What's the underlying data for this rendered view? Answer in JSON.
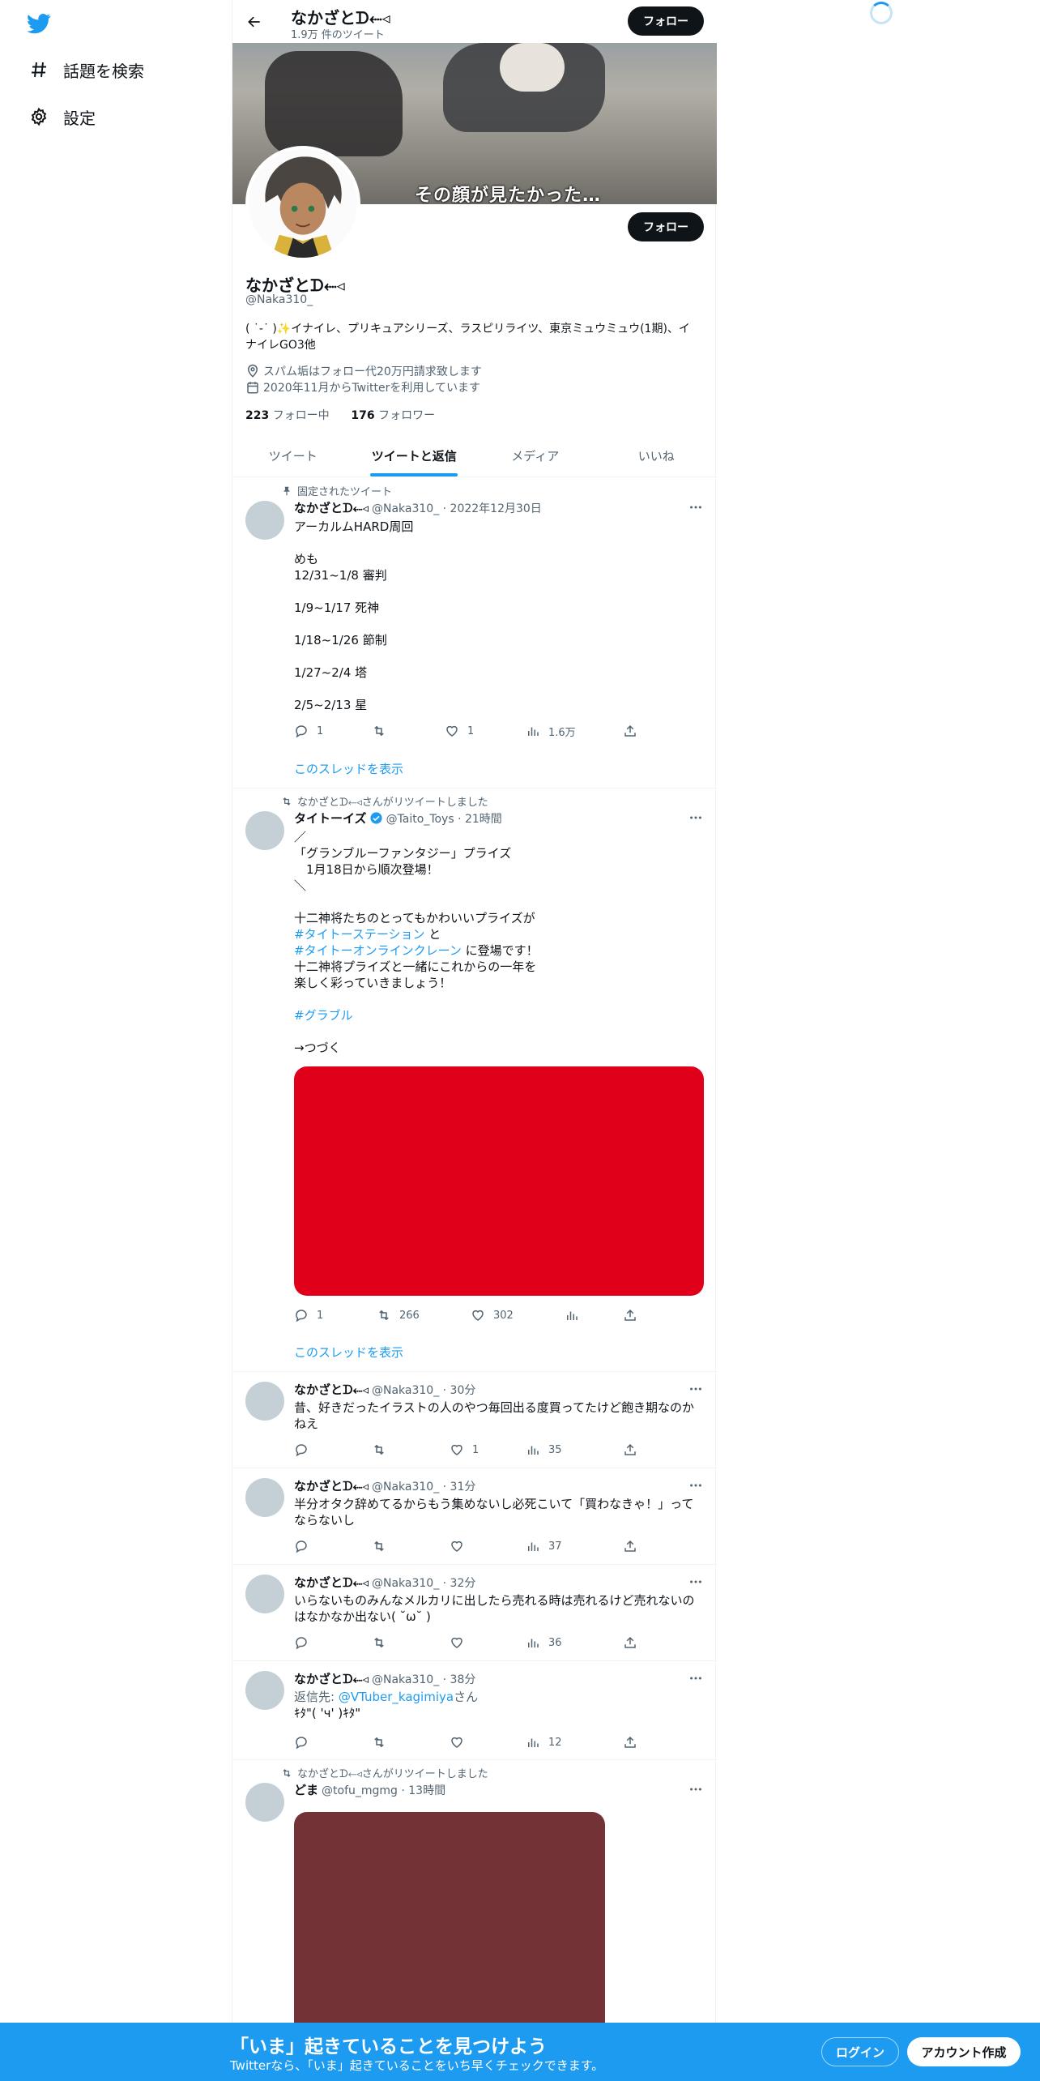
{
  "nav": {
    "explore_label": "話題を検索",
    "settings_label": "設定"
  },
  "topbar": {
    "name": "なかざとᗪ⬸◃",
    "tweet_count": "1.9万 件のツイート",
    "follow_label": "フォロー"
  },
  "banner": {
    "caption": "その顔が見たかった…"
  },
  "profile": {
    "follow_label": "フォロー",
    "name": "なかざとᗪ⬸◃",
    "handle": "@Naka310_",
    "bio": "( ˙-˙ )✨イナイレ、プリキュアシリーズ、ラスピリライツ、東京ミュウミュウ(1期)、イナイレGO3他",
    "location": "スパム垢はフォロー代20万円請求致します",
    "joined": "2020年11月からTwitterを利用しています",
    "following_count": "223",
    "following_label": "フォロー中",
    "followers_count": "176",
    "followers_label": "フォロワー"
  },
  "tabs": [
    "ツイート",
    "ツイートと返信",
    "メディア",
    "いいね"
  ],
  "active_tab": "ツイートと返信",
  "tweets": [
    {
      "context": "固定されたツイート",
      "name": "なかざとᗪ⬸◃",
      "handle_time": "@Naka310_ · 2022年12月30日",
      "body": "アーカルムHARD周回\n\nめも\n12/31~1/8 審判\n\n1/9~1/17 死神\n\n1/18~1/26 節制\n\n1/27~2/4 塔\n\n2/5~2/13 星",
      "replies": "1",
      "retweets": "",
      "likes": "1",
      "views": "1.6万",
      "thread_label": "このスレッドを表示"
    },
    {
      "context": "なかざとᗪ⬸◃さんがリツイートしました",
      "name": "タイトーイズ",
      "handle_time": "@Taito_Toys · 21時間",
      "body_1": "／\n「グランブルーファンタジー」プライズ\n　1月18日から順次登場！\n＼\n\n十二神将たちのとってもかわいいプライズが",
      "hashtag_1": "#タイトーステーション",
      "body_2": " と",
      "hashtag_2": "#タイトーオンラインクレーン",
      "body_3": " に登場です！\n十二神将プライズと一緒にこれからの一年を\n楽しく彩っていきましょう！",
      "hashtag_3": "#グラブル",
      "body_4": "→つづく",
      "replies": "1",
      "retweets": "266",
      "likes": "302",
      "views": "",
      "thread_label": "このスレッドを表示",
      "media_color": "#e00019"
    },
    {
      "name": "なかざとᗪ⬸◃",
      "handle_time": "@Naka310_ · 30分",
      "body": "昔、好きだったイラストの人のやつ毎回出る度買ってたけど飽き期なのかねえ",
      "replies": "",
      "retweets": "",
      "likes": "1",
      "views": "35"
    },
    {
      "name": "なかざとᗪ⬸◃",
      "handle_time": "@Naka310_ · 31分",
      "body": "半分オタク辞めてるからもう集めないし必死こいて「買わなきゃ！」ってならないし",
      "replies": "",
      "retweets": "",
      "likes": "",
      "views": "37"
    },
    {
      "name": "なかざとᗪ⬸◃",
      "handle_time": "@Naka310_ · 32分",
      "body": "いらないものみんなメルカリに出したら売れる時は売れるけど売れないのはなかなか出ない( ˘ω˘ )",
      "replies": "",
      "retweets": "",
      "likes": "",
      "views": "36"
    },
    {
      "name": "なかざとᗪ⬸◃",
      "handle_time": "@Naka310_ · 38分",
      "reply_prefix": "返信先: ",
      "reply_to": "@VTuber_kagimiya",
      "reply_suffix": "さん",
      "body": "ｷﾀ\"( 'ч' )ｷﾀ\"",
      "replies": "",
      "retweets": "",
      "likes": "",
      "views": "12"
    },
    {
      "context": "なかざとᗪ⬸◃さんがリツイートしました",
      "name": "どま",
      "handle_time": "@tofu_mgmg · 13時間",
      "media_color": "#733236"
    }
  ],
  "bottombar": {
    "title": "「いま」起きていることを見つけよう",
    "subtitle": "Twitterなら、「いま」起きていることをいち早くチェックできます。",
    "login": "ログイン",
    "signup": "アカウント作成"
  },
  "colors": {
    "accent": "#1d9bf0",
    "text": "#0f1419",
    "secondary": "#536471"
  }
}
